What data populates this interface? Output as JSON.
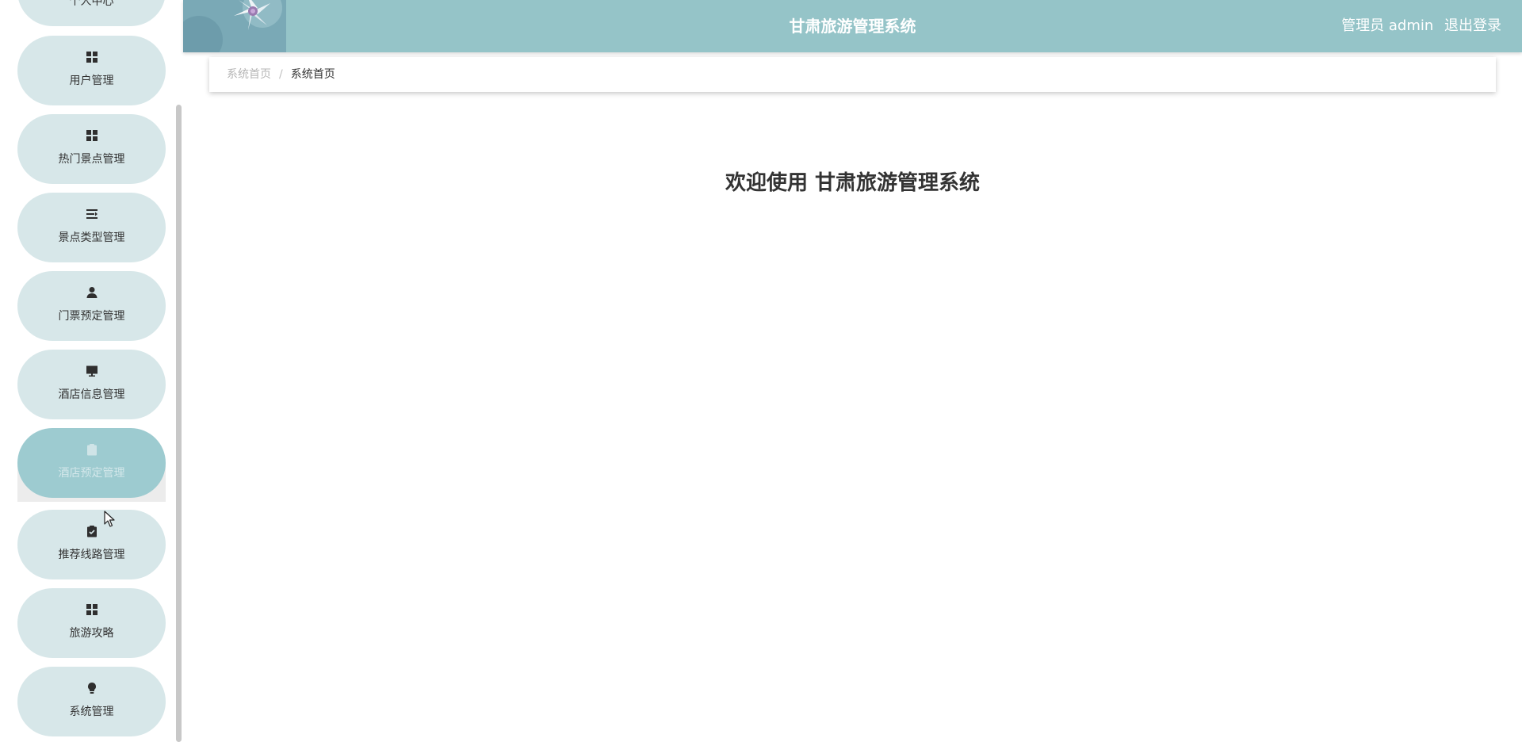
{
  "header": {
    "title": "甘肃旅游管理系统",
    "user_label": "管理员 admin",
    "logout_label": "退出登录"
  },
  "breadcrumb": {
    "home": "系统首页",
    "separator": "/",
    "current": "系统首页"
  },
  "welcome": "欢迎使用 甘肃旅游管理系统",
  "sidebar": {
    "items": [
      {
        "label": "个人中心",
        "icon": "person-icon"
      },
      {
        "label": "用户管理",
        "icon": "grid-icon"
      },
      {
        "label": "热门景点管理",
        "icon": "grid-icon"
      },
      {
        "label": "景点类型管理",
        "icon": "list-indent-icon"
      },
      {
        "label": "门票预定管理",
        "icon": "person-icon"
      },
      {
        "label": "酒店信息管理",
        "icon": "monitor-icon"
      },
      {
        "label": "酒店预定管理",
        "icon": "clipboard-icon",
        "active": true
      },
      {
        "label": "推荐线路管理",
        "icon": "clipboard-check-icon"
      },
      {
        "label": "旅游攻略",
        "icon": "grid-icon"
      },
      {
        "label": "系统管理",
        "icon": "bulb-icon"
      }
    ]
  },
  "colors": {
    "header_bg": "#95c4c8",
    "menu_bg": "#d7e7e9",
    "menu_active_bg": "#9dcbd0"
  }
}
